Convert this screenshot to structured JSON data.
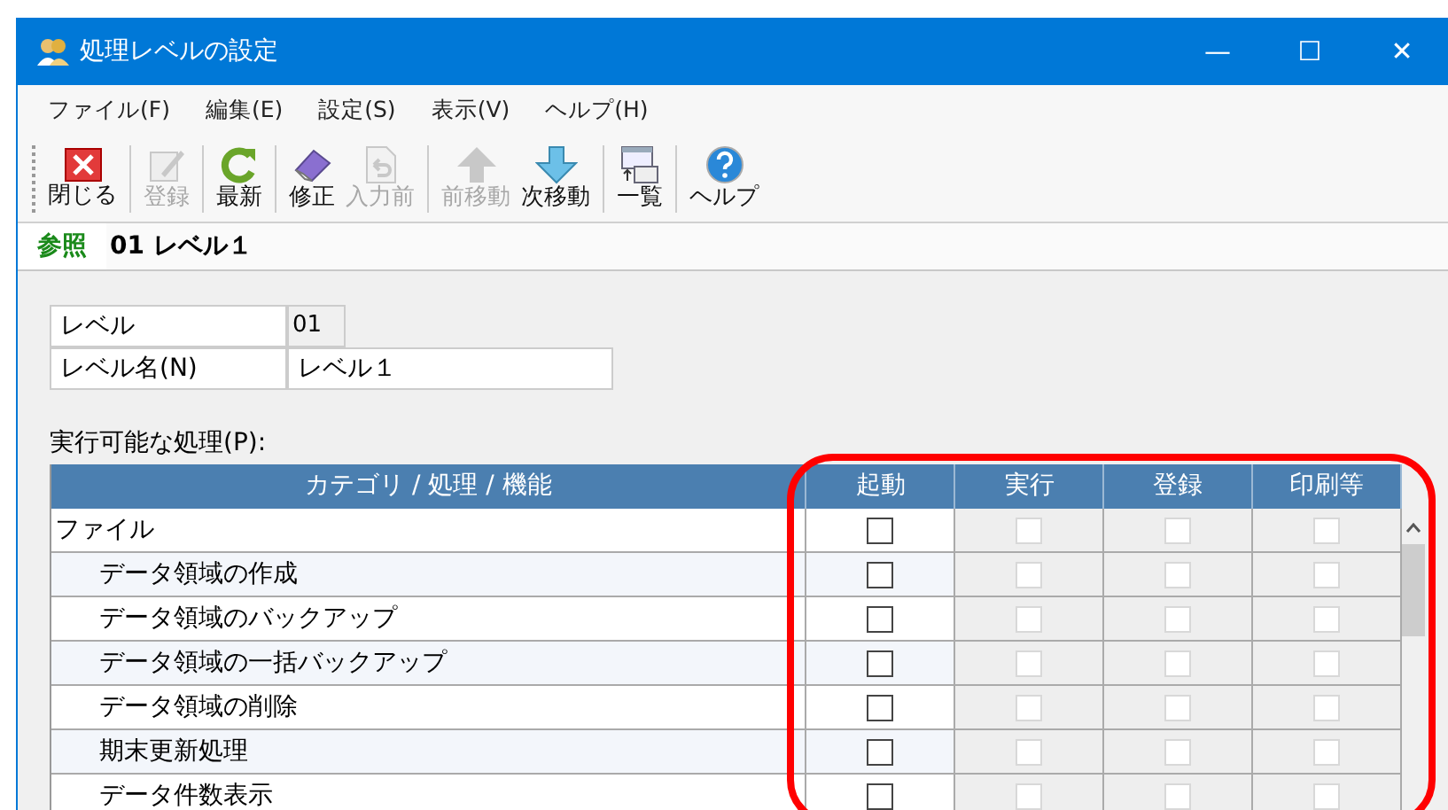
{
  "window": {
    "title": "処理レベルの設定",
    "controls": [
      "—",
      "☐",
      "✕"
    ]
  },
  "menu": [
    "ファイル(F)",
    "編集(E)",
    "設定(S)",
    "表示(V)",
    "ヘルプ(H)"
  ],
  "toolbar": [
    {
      "label": "閉じる",
      "kind": "close",
      "disabled": false,
      "sep": true
    },
    {
      "label": "登録",
      "kind": "edit",
      "disabled": true,
      "sep": true
    },
    {
      "label": "最新",
      "kind": "refresh",
      "disabled": false,
      "sep": true
    },
    {
      "label": "修正",
      "kind": "eraser",
      "disabled": false,
      "sep": false
    },
    {
      "label": "入力前",
      "kind": "undo",
      "disabled": true,
      "sep": true
    },
    {
      "label": "前移動",
      "kind": "up",
      "disabled": true,
      "sep": false
    },
    {
      "label": "次移動",
      "kind": "down",
      "disabled": false,
      "sep": true
    },
    {
      "label": "一覧",
      "kind": "list",
      "disabled": false,
      "sep": true
    },
    {
      "label": "ヘルプ",
      "kind": "help",
      "disabled": false,
      "sep": false
    }
  ],
  "mode": {
    "badge": "参照",
    "record": "01 レベル１"
  },
  "form": {
    "level_label": "レベル",
    "level_value": "01",
    "name_label": "レベル名(N)",
    "name_value": "レベル１"
  },
  "grid": {
    "label": "実行可能な処理(P):",
    "columns": [
      "カテゴリ / 処理 / 機能",
      "起動",
      "実行",
      "登録",
      "印刷等"
    ],
    "rows": [
      {
        "label": "ファイル",
        "cells": [
          {
            "checked": false,
            "disabled": false
          },
          {
            "checked": false,
            "disabled": true
          },
          {
            "checked": false,
            "disabled": true
          },
          {
            "checked": false,
            "disabled": true
          }
        ],
        "children": [
          {
            "label": "データ領域の作成",
            "cells": [
              {
                "checked": false,
                "disabled": false
              },
              {
                "checked": false,
                "disabled": true
              },
              {
                "checked": false,
                "disabled": true
              },
              {
                "checked": false,
                "disabled": true
              }
            ]
          },
          {
            "label": "データ領域のバックアップ",
            "cells": [
              {
                "checked": false,
                "disabled": false
              },
              {
                "checked": false,
                "disabled": true
              },
              {
                "checked": false,
                "disabled": true
              },
              {
                "checked": false,
                "disabled": true
              }
            ]
          },
          {
            "label": "データ領域の一括バックアップ",
            "cells": [
              {
                "checked": false,
                "disabled": false
              },
              {
                "checked": false,
                "disabled": true
              },
              {
                "checked": false,
                "disabled": true
              },
              {
                "checked": false,
                "disabled": true
              }
            ]
          },
          {
            "label": "データ領域の削除",
            "cells": [
              {
                "checked": false,
                "disabled": false
              },
              {
                "checked": false,
                "disabled": true
              },
              {
                "checked": false,
                "disabled": true
              },
              {
                "checked": false,
                "disabled": true
              }
            ]
          },
          {
            "label": "期末更新処理",
            "cells": [
              {
                "checked": false,
                "disabled": false
              },
              {
                "checked": false,
                "disabled": true
              },
              {
                "checked": false,
                "disabled": true
              },
              {
                "checked": false,
                "disabled": true
              }
            ]
          },
          {
            "label": "データ件数表示",
            "cells": [
              {
                "checked": false,
                "disabled": false
              },
              {
                "checked": false,
                "disabled": true
              },
              {
                "checked": false,
                "disabled": true
              },
              {
                "checked": false,
                "disabled": true
              }
            ]
          }
        ]
      }
    ]
  }
}
